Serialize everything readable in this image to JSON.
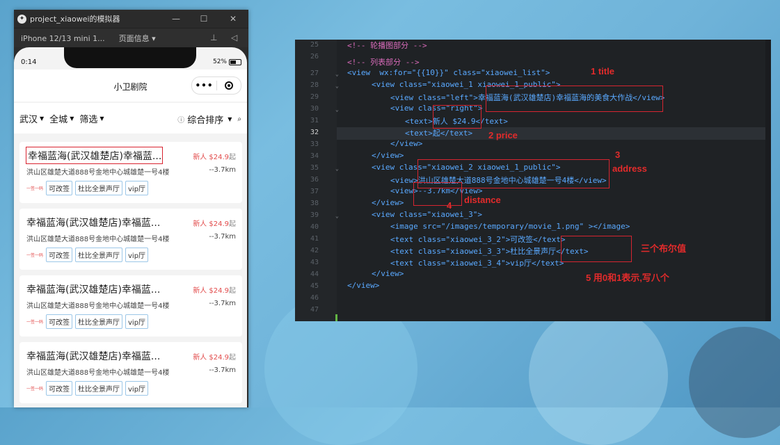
{
  "simulator": {
    "window_title": "project_xiaowei的模拟器",
    "device_label": "iPhone 12/13 mini 1...",
    "page_info_label": "页面信息 ▾",
    "status": {
      "time": "0:14",
      "battery": "52%"
    },
    "navbar_title": "小卫剧院",
    "filter": {
      "city": "武汉",
      "area": "全城",
      "filter": "筛选",
      "sort": "综合排序"
    },
    "cards": [
      {
        "title": "幸福蓝海(武汉雄楚店)幸福蓝...",
        "price": "新人 $24.9",
        "price_suffix": "起",
        "address": "洪山区雄楚大道888号金地中心城雄楚一号4楼",
        "distance": "--3.7km",
        "qian": "一签一码",
        "tags": [
          "可改签",
          "杜比全景声厅",
          "vip厅"
        ]
      },
      {
        "title": "幸福蓝海(武汉雄楚店)幸福蓝...",
        "price": "新人 $24.9",
        "price_suffix": "起",
        "address": "洪山区雄楚大道888号金地中心城雄楚一号4楼",
        "distance": "--3.7km",
        "qian": "一签一码",
        "tags": [
          "可改签",
          "杜比全景声厅",
          "vip厅"
        ]
      },
      {
        "title": "幸福蓝海(武汉雄楚店)幸福蓝...",
        "price": "新人 $24.9",
        "price_suffix": "起",
        "address": "洪山区雄楚大道888号金地中心城雄楚一号4楼",
        "distance": "--3.7km",
        "qian": "一签一码",
        "tags": [
          "可改签",
          "杜比全景声厅",
          "vip厅"
        ]
      },
      {
        "title": "幸福蓝海(武汉雄楚店)幸福蓝...",
        "price": "新人 $24.9",
        "price_suffix": "起",
        "address": "洪山区雄楚大道888号金地中心城雄楚一号4楼",
        "distance": "--3.7km",
        "qian": "一签一码",
        "tags": [
          "可改签",
          "杜比全景声厅",
          "vip厅"
        ]
      }
    ]
  },
  "editor": {
    "line_numbers": [
      "25",
      "26",
      "27",
      "28",
      "29",
      "30",
      "31",
      "32",
      "33",
      "34",
      "35",
      "36",
      "37",
      "38",
      "39",
      "40",
      "41",
      "42",
      "43",
      "44",
      "45",
      "46",
      "47"
    ],
    "current_line": "32",
    "code": {
      "l25": "<!-- 轮播图部分 -->",
      "l26": "",
      "l27": "<!-- 列表部分 -->",
      "l28": "<view  wx:for=\"{{10}}\" class=\"xiaowei_list\">",
      "l29": "<view class=\"xiaowei_1 xiaowei_1_public\">",
      "l30": "<view class=\"left\">幸福蓝海(武汉雄楚店)幸福蓝海的美食大作战</view>",
      "l31": "<view class=\"right\">",
      "l32": "<text>新人 $24.9</text>",
      "l33": "<text>起</text>",
      "l34": "</view>",
      "l35": "</view>",
      "l36": "<view class=\"xiaowei_2 xiaowei_1_public\">",
      "l37": "<view>洪山区雄楚大道888号金地中心城雄楚一号4楼</view>",
      "l38": "<view>--3.7km</view>",
      "l39": "</view>",
      "l40": "<view class=\"xiaowei_3\">",
      "l41": "<image src=\"/images/temporary/movie_1.png\" ></image>",
      "l42": "<text class=\"xiaowei_3_2\">可改签</text>",
      "l43": "<text class=\"xiaowei_3_3\">杜比全景声厅</text>",
      "l44": "<text class=\"xiaowei_3_4\">vip厅</text>",
      "l45": "</view>",
      "l46": "</view>"
    },
    "annotations": {
      "a1": "1  title",
      "a2": "2 price",
      "a3_num": "3",
      "a3_word": "address",
      "a4_word": "distance",
      "a4_num": "4",
      "a5": "三个布尔值",
      "a6": "5 用0和1表示,写八个"
    }
  }
}
